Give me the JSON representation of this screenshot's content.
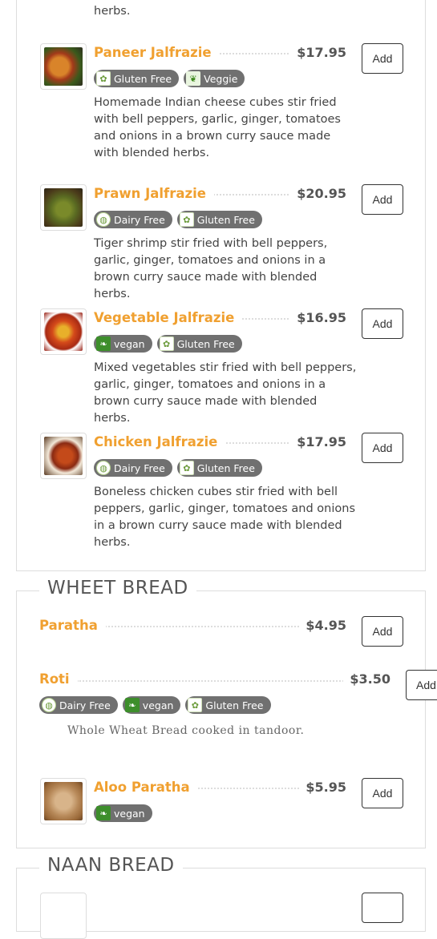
{
  "top_section": {
    "clipped_desc_tail": "herbs.",
    "items": [
      {
        "name": "Paneer Jalfrazie",
        "price": "$17.95",
        "add": "Add",
        "badges": [
          {
            "label": "Gluten Free",
            "icon": "gluten-free-icon"
          },
          {
            "label": "Veggie",
            "icon": "veggie-icon"
          }
        ],
        "desc": "Homemade Indian cheese cubes stir fried with bell peppers, garlic, ginger, tomatoes and onions in a brown curry sauce made with blended herbs."
      },
      {
        "name": "Prawn Jalfrazie",
        "price": "$20.95",
        "add": "Add",
        "badges": [
          {
            "label": "Dairy Free",
            "icon": "dairy-free-icon"
          },
          {
            "label": "Gluten Free",
            "icon": "gluten-free-icon"
          }
        ],
        "desc": "Tiger shrimp stir fried with bell peppers, garlic, ginger, tomatoes and onions in a brown curry sauce made with blended herbs."
      },
      {
        "name": "Vegetable Jalfrazie",
        "price": "$16.95",
        "add": "Add",
        "badges": [
          {
            "label": "vegan",
            "icon": "vegan-icon"
          },
          {
            "label": "Gluten Free",
            "icon": "gluten-free-icon"
          }
        ],
        "desc": "Mixed vegetables stir fried with bell peppers, garlic, ginger, tomatoes and onions in a brown curry sauce made with blended herbs."
      },
      {
        "name": "Chicken Jalfrazie",
        "price": "$17.95",
        "add": "Add",
        "badges": [
          {
            "label": "Dairy Free",
            "icon": "dairy-free-icon"
          },
          {
            "label": "Gluten Free",
            "icon": "gluten-free-icon"
          }
        ],
        "desc": "Boneless chicken cubes stir fried with bell peppers, garlic, ginger, tomatoes and onions in a brown curry sauce made with blended herbs."
      }
    ]
  },
  "wheat_bread": {
    "title": "WHEET BREAD",
    "items": [
      {
        "name": "Paratha",
        "price": "$4.95",
        "add": "Add"
      },
      {
        "name": "Roti",
        "price": "$3.50",
        "add": "Add",
        "badges": [
          {
            "label": "Dairy Free",
            "icon": "dairy-free-icon"
          },
          {
            "label": "vegan",
            "icon": "vegan-icon"
          },
          {
            "label": "Gluten Free",
            "icon": "gluten-free-icon"
          }
        ],
        "desc": "Whole Wheat Bread cooked in tandoor."
      },
      {
        "name": "Aloo Paratha",
        "price": "$5.95",
        "add": "Add",
        "badges": [
          {
            "label": "vegan",
            "icon": "vegan-icon"
          }
        ]
      }
    ]
  },
  "naan_bread": {
    "title": "NAAN BREAD"
  }
}
